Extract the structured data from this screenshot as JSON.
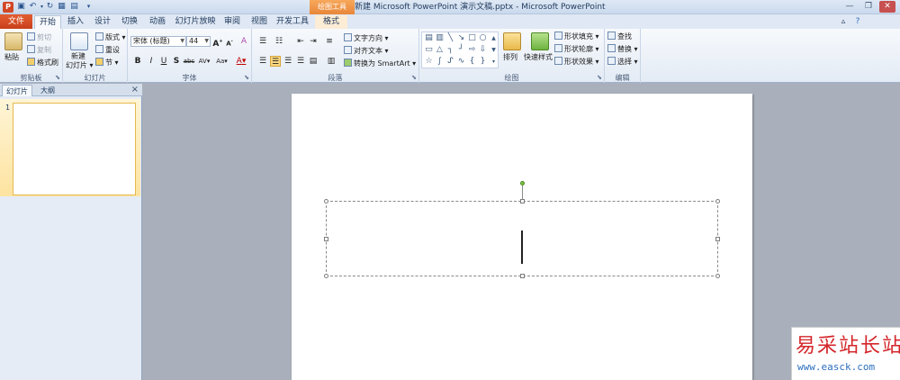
{
  "quick_access": {
    "app_icon": "P",
    "items": [
      "save-icon",
      "undo-icon",
      "redo-icon",
      "customize-icon"
    ]
  },
  "title_bar": {
    "context_tab_group": "绘图工具",
    "window_title": "新建 Microsoft PowerPoint 演示文稿.pptx - Microsoft PowerPoint",
    "buttons": [
      "minimize",
      "maximize",
      "close"
    ]
  },
  "tabs": {
    "file": "文件",
    "items": [
      "开始",
      "插入",
      "设计",
      "切换",
      "动画",
      "幻灯片放映",
      "审阅",
      "视图",
      "开发工具",
      "格式"
    ],
    "active": "开始"
  },
  "ribbon": {
    "clipboard": {
      "label": "剪贴板",
      "paste": "粘贴",
      "cut": "剪切",
      "copy": "复制",
      "format_painter": "格式刷"
    },
    "slides": {
      "label": "幻灯片",
      "new_slide_line1": "新建",
      "new_slide_line2": "幻灯片",
      "layout": "版式",
      "reset": "重设",
      "section": "节"
    },
    "font": {
      "label": "字体",
      "font_name": "宋体 (标题)",
      "font_size": "44",
      "grow": "A",
      "shrink": "A",
      "clear": "A",
      "bold": "B",
      "italic": "I",
      "underline": "U",
      "shadow": "S",
      "strike": "abc",
      "spacing": "AV",
      "case": "Aa",
      "color": "A"
    },
    "paragraph": {
      "label": "段落",
      "text_direction": "文字方向",
      "align_text": "对齐文本",
      "smartart": "转换为 SmartArt"
    },
    "drawing": {
      "label": "绘图",
      "arrange": "排列",
      "quick_styles": "快速样式",
      "shape_fill": "形状填充",
      "shape_outline": "形状轮廓",
      "shape_effects": "形状效果"
    },
    "editing": {
      "label": "编辑",
      "find": "查找",
      "replace": "替换",
      "select": "选择"
    }
  },
  "slide_panel": {
    "tabs": [
      "幻灯片",
      "大纲"
    ],
    "active_tab": "幻灯片",
    "close": "×",
    "thumbnails": [
      {
        "number": "1",
        "selected": true
      }
    ]
  },
  "editor": {
    "placeholder_text": "",
    "caret_visible": true
  },
  "watermark": {
    "title": "易采站长站",
    "url": "www.easck.com"
  },
  "colors": {
    "file_tab": "#c8401c",
    "context_tab": "#e8873a",
    "ribbon_bg": "#f7f9fc",
    "workspace_bg": "#a9b0bb",
    "watermark_red": "#d4262a",
    "watermark_blue": "#2c6fbf"
  }
}
